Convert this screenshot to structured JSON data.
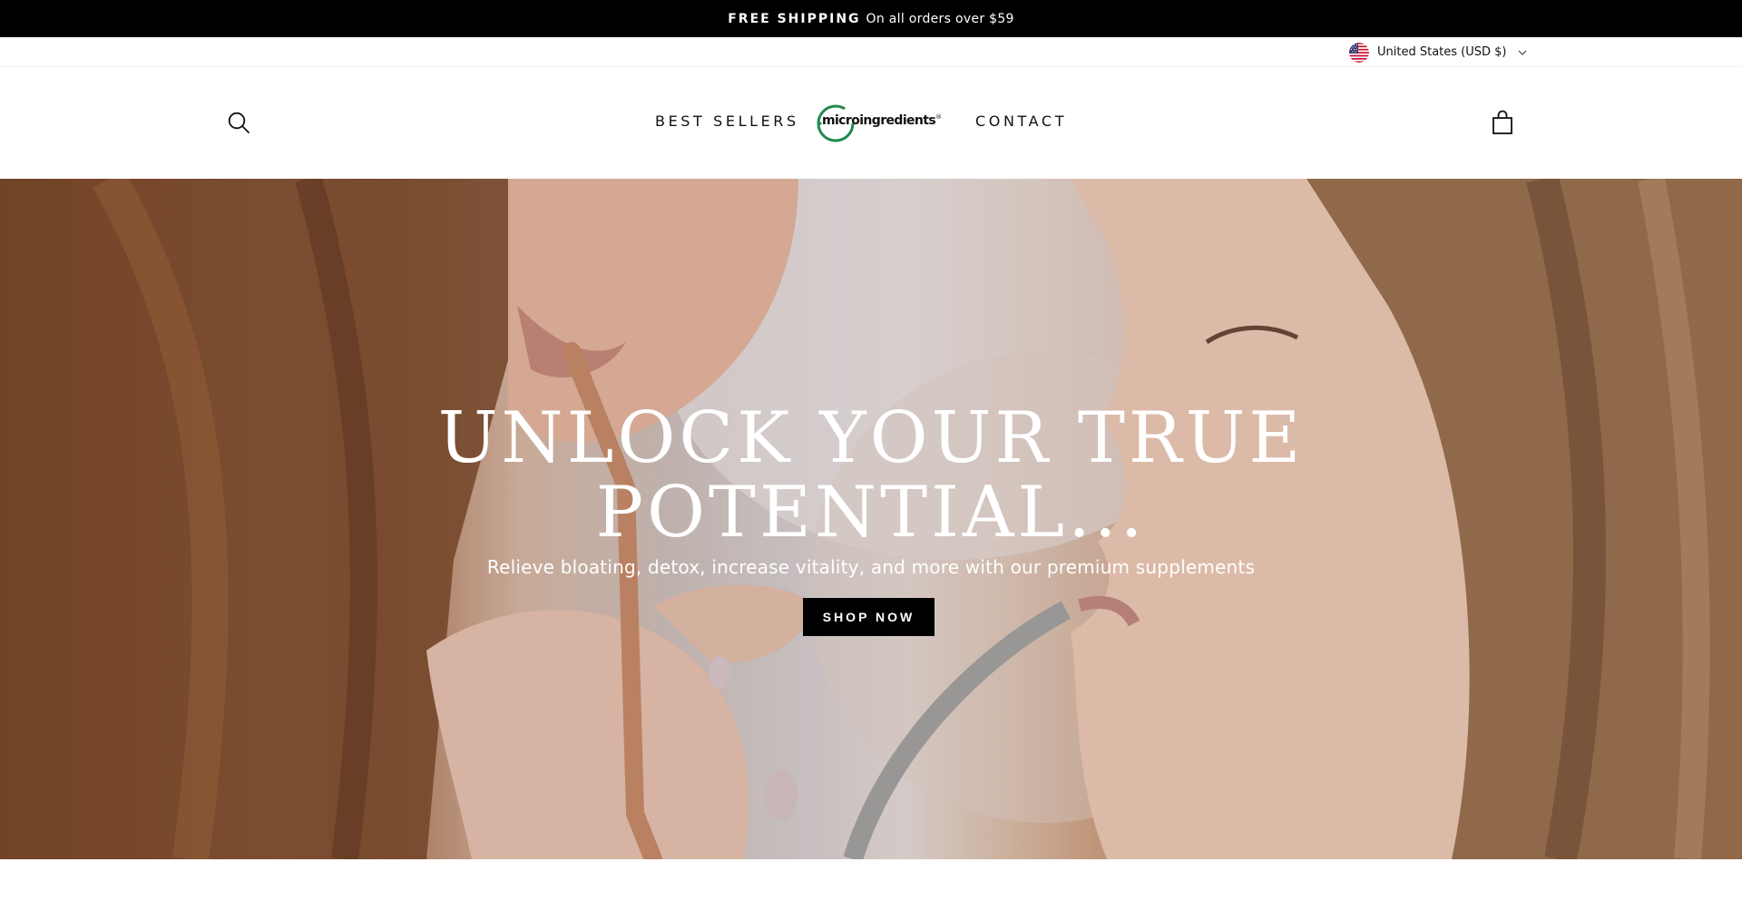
{
  "announcement": {
    "bold_text": "FREE SHIPPING",
    "text": "On all orders over $59"
  },
  "currency": {
    "label": "United States (USD $)",
    "flag_icon": "us-flag-icon"
  },
  "header": {
    "nav": {
      "best_sellers": "BEST SELLERS",
      "contact": "CONTACT"
    },
    "logo": {
      "prefix": "micro",
      "suffix": "ingredients",
      "mark": "®"
    },
    "icons": {
      "search": "search-icon",
      "cart": "cart-icon"
    }
  },
  "hero": {
    "title_line1": "UNLOCK YOUR TRUE",
    "title_line2": "POTENTIAL...",
    "subtitle": "Relieve bloating, detox, increase vitality, and more with our premium supplements",
    "cta": "SHOP NOW"
  },
  "colors": {
    "announcement_bg": "#000000",
    "button_bg": "#000000",
    "logo_green": "#1f8a4c"
  }
}
